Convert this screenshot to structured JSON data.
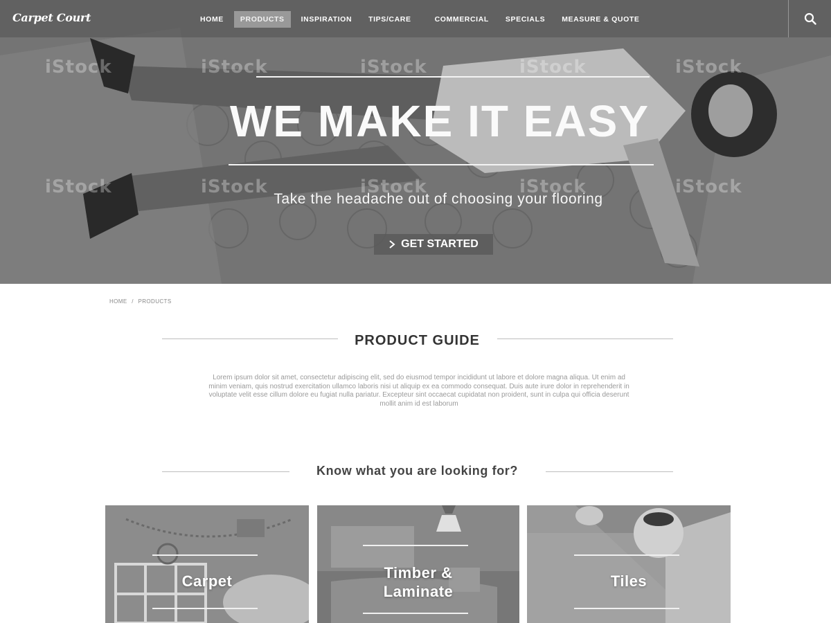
{
  "brand": {
    "logo_text": "Carpet Court"
  },
  "nav": {
    "items": [
      {
        "label": "HOME",
        "active": false
      },
      {
        "label": "PRODUCTS",
        "active": true
      },
      {
        "label": "INSPIRATION",
        "active": false
      },
      {
        "label": "TIPS/CARE",
        "active": false
      },
      {
        "label": "COMMERCIAL",
        "active": false
      },
      {
        "label": "SPECIALS",
        "active": false
      },
      {
        "label": "MEASURE & QUOTE",
        "active": false
      }
    ],
    "search_icon": "search-icon"
  },
  "hero": {
    "title": "WE MAKE IT EASY",
    "subtitle": "Take the headache out of choosing your flooring",
    "cta_label": "GET STARTED",
    "cta_icon": "chevron-right-icon",
    "watermark_text": "iStock"
  },
  "breadcrumb": {
    "home": "HOME",
    "separator": "/",
    "current": "PRODUCTS"
  },
  "product_guide": {
    "title": "PRODUCT GUIDE",
    "intro": "Lorem ipsum dolor sit amet, consectetur adipiscing elit, sed do eiusmod tempor incididunt ut labore et dolore magna aliqua. Ut enim ad minim veniam, quis nostrud exercitation ullamco laboris nisi ut aliquip ex ea commodo consequat. Duis aute irure dolor in reprehenderit in voluptate velit esse cillum dolore eu fugiat nulla pariatur. Excepteur sint occaecat cupidatat non proident, sunt in culpa qui officia deserunt mollit anim id est laborum"
  },
  "lookup": {
    "title": "Know what you are looking for?"
  },
  "categories": [
    {
      "label": "Carpet"
    },
    {
      "label": "Timber & Laminate"
    },
    {
      "label": "Tiles"
    }
  ]
}
